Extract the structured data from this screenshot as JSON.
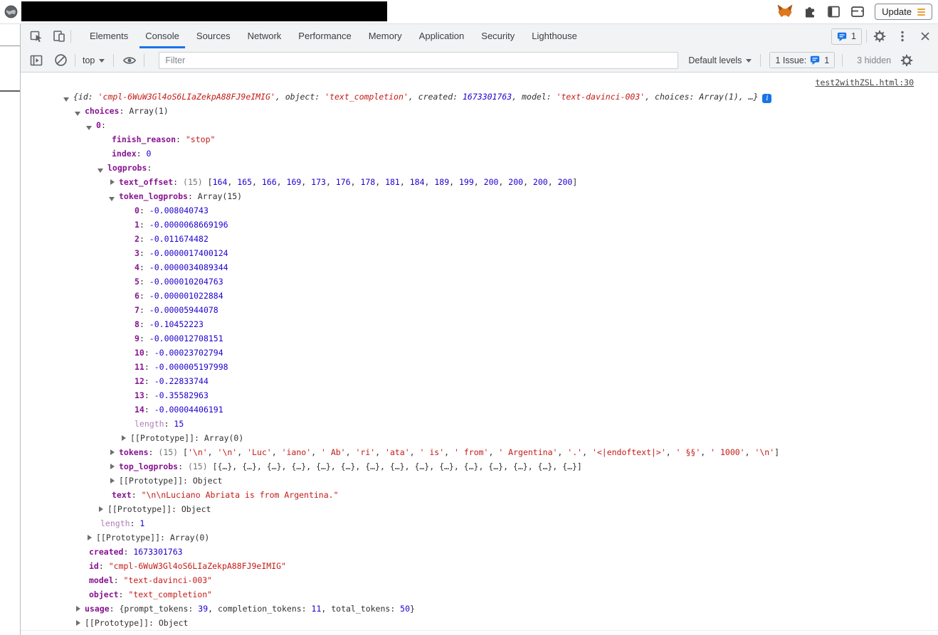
{
  "colors": {
    "accent": "#1a73e8",
    "key_purple": "#881391",
    "number_blue": "#1c00cf",
    "string_red": "#c41a16",
    "toolbar_bg": "#f1f3f4",
    "icon_gray": "#5f6368",
    "metamask_orange": "#e2761b",
    "update_amber": "#e8a33d"
  },
  "browser": {
    "favicon": "globe-icon",
    "title_redacted": true,
    "extensions": [
      "metamask-icon",
      "extensions-puzzle-icon",
      "side-panel-icon",
      "wallet-icon"
    ],
    "update_button": {
      "label": "Update"
    }
  },
  "devtools": {
    "tabs": [
      "Elements",
      "Console",
      "Sources",
      "Network",
      "Performance",
      "Memory",
      "Application",
      "Security",
      "Lighthouse"
    ],
    "active_tab": "Console",
    "tabbar_right": {
      "messages_count": "1"
    },
    "toolbar": {
      "context_label": "top",
      "filter_placeholder": "Filter",
      "levels_label": "Default levels",
      "issues_label": "1 Issue:",
      "issues_count": "1",
      "hidden_label": "3 hidden"
    }
  },
  "console": {
    "source_link": "test2withZSL.html:30",
    "preview": {
      "arrow": "d",
      "info_badge": "i",
      "parts": [
        [
          "pl",
          "{id: "
        ],
        [
          "s",
          "'cmpl-6WuW3Gl4oS6LIaZekpA88FJ9eIMIG'"
        ],
        [
          "pl",
          ", object: "
        ],
        [
          "s",
          "'text_completion'"
        ],
        [
          "pl",
          ", created: "
        ],
        [
          "n",
          "1673301763"
        ],
        [
          "pl",
          ", model: "
        ],
        [
          "s",
          "'text-davinci-003'"
        ],
        [
          "pl",
          ", choices: "
        ],
        [
          "pl",
          "Array(1)"
        ],
        [
          "pl",
          ", …}"
        ]
      ]
    },
    "rows": [
      {
        "l": 1,
        "a": "d",
        "n": "choices",
        "ns": "key",
        "p": [
          [
            "pl",
            ": "
          ],
          [
            "pl",
            "Array(1)"
          ]
        ]
      },
      {
        "l": 2,
        "a": "d",
        "n": "0",
        "ns": "key",
        "p": [
          [
            "pl",
            ":"
          ]
        ]
      },
      {
        "l": 3,
        "a": null,
        "n": "finish_reason",
        "ns": "key",
        "p": [
          [
            "pl",
            ": "
          ],
          [
            "s",
            "\"stop\""
          ]
        ]
      },
      {
        "l": 3,
        "a": null,
        "n": "index",
        "ns": "key",
        "p": [
          [
            "pl",
            ": "
          ],
          [
            "n",
            "0"
          ]
        ]
      },
      {
        "l": 3,
        "a": "d",
        "n": "logprobs",
        "ns": "key",
        "p": [
          [
            "pl",
            ":"
          ]
        ]
      },
      {
        "l": 4,
        "a": "r",
        "n": "text_offset",
        "ns": "key",
        "p": [
          [
            "pl",
            ": "
          ],
          [
            "g",
            "(15) "
          ],
          [
            "na",
            "[164, 165, 166, 169, 173, 176, 178, 181, 184, 189, 199, 200, 200, 200, 200]"
          ]
        ]
      },
      {
        "l": 4,
        "a": "d",
        "n": "token_logprobs",
        "ns": "key",
        "p": [
          [
            "pl",
            ": "
          ],
          [
            "pl",
            "Array(15)"
          ]
        ]
      },
      {
        "l": 5,
        "a": null,
        "n": "0",
        "ns": "key",
        "p": [
          [
            "pl",
            ": "
          ],
          [
            "n",
            "-0.008040743"
          ]
        ]
      },
      {
        "l": 5,
        "a": null,
        "n": "1",
        "ns": "key",
        "p": [
          [
            "pl",
            ": "
          ],
          [
            "n",
            "-0.0000068669196"
          ]
        ]
      },
      {
        "l": 5,
        "a": null,
        "n": "2",
        "ns": "key",
        "p": [
          [
            "pl",
            ": "
          ],
          [
            "n",
            "-0.011674482"
          ]
        ]
      },
      {
        "l": 5,
        "a": null,
        "n": "3",
        "ns": "key",
        "p": [
          [
            "pl",
            ": "
          ],
          [
            "n",
            "-0.0000017400124"
          ]
        ]
      },
      {
        "l": 5,
        "a": null,
        "n": "4",
        "ns": "key",
        "p": [
          [
            "pl",
            ": "
          ],
          [
            "n",
            "-0.0000034089344"
          ]
        ]
      },
      {
        "l": 5,
        "a": null,
        "n": "5",
        "ns": "key",
        "p": [
          [
            "pl",
            ": "
          ],
          [
            "n",
            "-0.000010204763"
          ]
        ]
      },
      {
        "l": 5,
        "a": null,
        "n": "6",
        "ns": "key",
        "p": [
          [
            "pl",
            ": "
          ],
          [
            "n",
            "-0.000001022884"
          ]
        ]
      },
      {
        "l": 5,
        "a": null,
        "n": "7",
        "ns": "key",
        "p": [
          [
            "pl",
            ": "
          ],
          [
            "n",
            "-0.00005944078"
          ]
        ]
      },
      {
        "l": 5,
        "a": null,
        "n": "8",
        "ns": "key",
        "p": [
          [
            "pl",
            ": "
          ],
          [
            "n",
            "-0.10452223"
          ]
        ]
      },
      {
        "l": 5,
        "a": null,
        "n": "9",
        "ns": "key",
        "p": [
          [
            "pl",
            ": "
          ],
          [
            "n",
            "-0.000012708151"
          ]
        ]
      },
      {
        "l": 5,
        "a": null,
        "n": "10",
        "ns": "key",
        "p": [
          [
            "pl",
            ": "
          ],
          [
            "n",
            "-0.00023702794"
          ]
        ]
      },
      {
        "l": 5,
        "a": null,
        "n": "11",
        "ns": "key",
        "p": [
          [
            "pl",
            ": "
          ],
          [
            "n",
            "-0.000005197998"
          ]
        ]
      },
      {
        "l": 5,
        "a": null,
        "n": "12",
        "ns": "key",
        "p": [
          [
            "pl",
            ": "
          ],
          [
            "n",
            "-0.22833744"
          ]
        ]
      },
      {
        "l": 5,
        "a": null,
        "n": "13",
        "ns": "key",
        "p": [
          [
            "pl",
            ": "
          ],
          [
            "n",
            "-0.35582963"
          ]
        ]
      },
      {
        "l": 5,
        "a": null,
        "n": "14",
        "ns": "key",
        "p": [
          [
            "pl",
            ": "
          ],
          [
            "n",
            "-0.00004406191"
          ]
        ]
      },
      {
        "l": 5,
        "a": null,
        "n": "length",
        "ns": "faded",
        "p": [
          [
            "pl",
            ": "
          ],
          [
            "n",
            "15"
          ]
        ]
      },
      {
        "l": 5,
        "a": "r",
        "n": "[[Prototype]]",
        "ns": "int",
        "p": [
          [
            "pl",
            ": "
          ],
          [
            "pl",
            "Array(0)"
          ]
        ]
      },
      {
        "l": 4,
        "a": "r",
        "n": "tokens",
        "ns": "key",
        "p": [
          [
            "pl",
            ": "
          ],
          [
            "g",
            "(15) "
          ],
          [
            "sa",
            "['\\n', '\\n', 'Luc', 'iano', ' Ab', 'ri', 'ata', ' is', ' from', ' Argentina', '.', '<|endoftext|>', ' §§', ' 1000', '\\n']"
          ]
        ]
      },
      {
        "l": 4,
        "a": "r",
        "n": "top_logprobs",
        "ns": "key",
        "p": [
          [
            "pl",
            ": "
          ],
          [
            "g",
            "(15) "
          ],
          [
            "pl",
            "[{…}, {…}, {…}, {…}, {…}, {…}, {…}, {…}, {…}, {…}, {…}, {…}, {…}, {…}, {…}]"
          ]
        ]
      },
      {
        "l": 4,
        "a": "r",
        "n": "[[Prototype]]",
        "ns": "int",
        "p": [
          [
            "pl",
            ": "
          ],
          [
            "pl",
            "Object"
          ]
        ]
      },
      {
        "l": 3,
        "a": null,
        "n": "text",
        "ns": "key",
        "p": [
          [
            "pl",
            ": "
          ],
          [
            "s",
            "\"\\n\\nLuciano Abriata is from Argentina.\""
          ]
        ]
      },
      {
        "l": 3,
        "a": "r",
        "n": "[[Prototype]]",
        "ns": "int",
        "p": [
          [
            "pl",
            ": "
          ],
          [
            "pl",
            "Object"
          ]
        ]
      },
      {
        "l": 2,
        "a": null,
        "n": "length",
        "ns": "faded",
        "p": [
          [
            "pl",
            ": "
          ],
          [
            "n",
            "1"
          ]
        ]
      },
      {
        "l": 2,
        "a": "r",
        "n": "[[Prototype]]",
        "ns": "int",
        "p": [
          [
            "pl",
            ": "
          ],
          [
            "pl",
            "Array(0)"
          ]
        ]
      },
      {
        "l": 1,
        "a": null,
        "n": "created",
        "ns": "key",
        "p": [
          [
            "pl",
            ": "
          ],
          [
            "n",
            "1673301763"
          ]
        ]
      },
      {
        "l": 1,
        "a": null,
        "n": "id",
        "ns": "key",
        "p": [
          [
            "pl",
            ": "
          ],
          [
            "s",
            "\"cmpl-6WuW3Gl4oS6LIaZekpA88FJ9eIMIG\""
          ]
        ]
      },
      {
        "l": 1,
        "a": null,
        "n": "model",
        "ns": "key",
        "p": [
          [
            "pl",
            ": "
          ],
          [
            "s",
            "\"text-davinci-003\""
          ]
        ]
      },
      {
        "l": 1,
        "a": null,
        "n": "object",
        "ns": "key",
        "p": [
          [
            "pl",
            ": "
          ],
          [
            "s",
            "\"text_completion\""
          ]
        ]
      },
      {
        "l": 1,
        "a": "r",
        "n": "usage",
        "ns": "key",
        "p": [
          [
            "pl",
            ": "
          ],
          [
            "pl",
            "{prompt_tokens: "
          ],
          [
            "n",
            "39"
          ],
          [
            "pl",
            ", completion_tokens: "
          ],
          [
            "n",
            "11"
          ],
          [
            "pl",
            ", total_tokens: "
          ],
          [
            "n",
            "50"
          ],
          [
            "pl",
            "}"
          ]
        ]
      },
      {
        "l": 1,
        "a": "r",
        "n": "[[Prototype]]",
        "ns": "int",
        "p": [
          [
            "pl",
            ": "
          ],
          [
            "pl",
            "Object"
          ]
        ]
      }
    ]
  }
}
